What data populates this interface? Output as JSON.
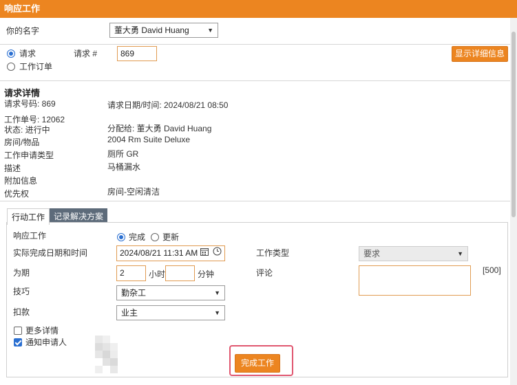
{
  "window": {
    "title": "响应工作"
  },
  "name_field": {
    "label": "你的名字",
    "value": "董大勇 David Huang"
  },
  "mode": {
    "options": [
      "请求",
      "工作订单"
    ],
    "selected": "请求",
    "request_no_label": "请求 #",
    "request_no_value": "869",
    "show_details_button": "显示详细信息"
  },
  "request_details": {
    "heading": "请求详情",
    "request_number": "请求号码: 869",
    "request_datetime": "请求日期/时间: 2024/08/21 08:50",
    "work_order_no": "工作单号: 12062",
    "status": "状态: 进行中",
    "assigned_label": "分配给: 董大勇 David Huang",
    "room_label": "房间/物品",
    "room_value": "2004 Rm Suite Deluxe",
    "type_label": "工作申请类型",
    "type_value": "厕所 GR",
    "desc_label": "描述",
    "desc_value": "马桶漏水",
    "extra_label": "附加信息",
    "priority_label": "优先权",
    "priority_value": "房间-空闲清洁"
  },
  "tabs": [
    {
      "label": "行动工作",
      "active": true
    },
    {
      "label": "记录解决方案",
      "active": false
    }
  ],
  "action_form": {
    "response_label": "响应工作",
    "response_options": [
      "完成",
      "更新"
    ],
    "response_selected": "完成",
    "completion_label": "实际完成日期和时间",
    "completion_value": "2024/08/21 11:31 AM",
    "duration_label": "为期",
    "hours_value": "2",
    "hours_unit": "小时",
    "minutes_value": "",
    "minutes_unit": "分钟",
    "skill_label": "技巧",
    "skill_value": "勤杂工",
    "deduction_label": "扣款",
    "deduction_value": "业主",
    "work_type_label": "工作类型",
    "work_type_value": "要求",
    "comment_label": "评论",
    "comment_value": "",
    "comment_limit": "[500]",
    "more_details_label": "更多详情",
    "more_details_checked": false,
    "notify_label": "通知申请人",
    "notify_checked": true,
    "complete_button": "完成工作"
  },
  "colors": {
    "accent": "#ec8520",
    "tab_inactive": "#5d6b7a",
    "highlight": "#e0566f",
    "radio": "#2a6fd1"
  }
}
